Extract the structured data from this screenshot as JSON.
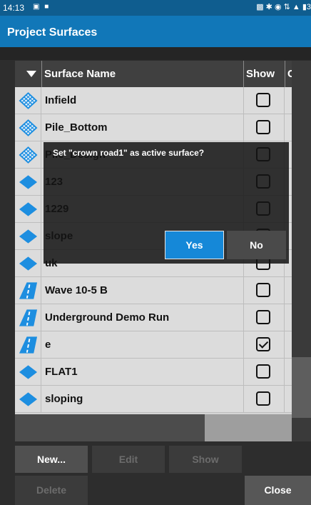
{
  "status_bar": {
    "time": "14:13",
    "left_icons": "▣ ■",
    "right_icons": "▩ ✱ ◉ ⇅ ▲ ▮3"
  },
  "header": {
    "title": "Project Surfaces"
  },
  "table": {
    "columns": {
      "name": "Surface Name",
      "show": "Show",
      "extra": "C"
    },
    "rows": [
      {
        "icon": "grid-surface-icon",
        "name": "Infield",
        "show": false
      },
      {
        "icon": "grid-surface-icon",
        "name": "Pile_Bottom",
        "show": false
      },
      {
        "icon": "grid-surface-icon",
        "name": "Pile_Design",
        "show": false
      },
      {
        "icon": "diamond-surface-icon",
        "name": "123",
        "show": false
      },
      {
        "icon": "diamond-surface-icon",
        "name": "1229",
        "show": false
      },
      {
        "icon": "diamond-surface-icon",
        "name": "slope",
        "show": false
      },
      {
        "icon": "diamond-surface-icon",
        "name": "uk",
        "show": false
      },
      {
        "icon": "road-surface-icon",
        "name": "Wave 10-5 B",
        "show": false
      },
      {
        "icon": "road-surface-icon",
        "name": "Underground Demo Run",
        "show": false
      },
      {
        "icon": "road-surface-icon",
        "name": "e",
        "show": true
      },
      {
        "icon": "diamond-surface-icon",
        "name": "FLAT1",
        "show": false
      },
      {
        "icon": "diamond-surface-icon",
        "name": "sloping",
        "show": false
      }
    ]
  },
  "buttons": {
    "new": "New...",
    "edit": "Edit",
    "show": "Show",
    "delete": "Delete",
    "close": "Close"
  },
  "dialog": {
    "message": "Set \"crown road1\" as active surface?",
    "yes": "Yes",
    "no": "No"
  },
  "colors": {
    "accent": "#1177b8",
    "icon_blue": "#1d8ee0",
    "yes_button": "#1588d8"
  }
}
